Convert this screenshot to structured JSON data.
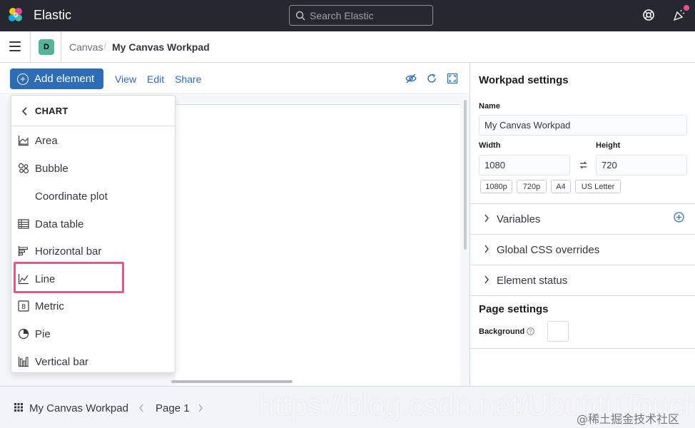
{
  "header": {
    "brand": "Elastic",
    "search_placeholder": "Search Elastic",
    "icons": [
      "elastic-logo-icon",
      "search-icon",
      "help-icon",
      "newsfeed-icon"
    ]
  },
  "breadcrumb": {
    "space_initial": "D",
    "items": [
      "Canvas",
      "My Canvas Workpad"
    ],
    "separator": "/"
  },
  "toolbar": {
    "add_label": "Add element",
    "links": [
      "View",
      "Edit",
      "Share"
    ],
    "icons": [
      "hide-icon",
      "refresh-icon",
      "fullscreen-icon"
    ]
  },
  "menu": {
    "back_icon": "chevron-left-icon",
    "title": "CHART",
    "items": [
      {
        "label": "Area",
        "icon": "area-chart-icon"
      },
      {
        "label": "Bubble",
        "icon": "bubble-chart-icon"
      },
      {
        "label": "Coordinate plot",
        "icon": ""
      },
      {
        "label": "Data table",
        "icon": "table-icon"
      },
      {
        "label": "Horizontal bar",
        "icon": "horizontal-bar-icon"
      },
      {
        "label": "Line",
        "icon": "line-chart-icon"
      },
      {
        "label": "Metric",
        "icon": "metric-icon"
      },
      {
        "label": "Pie",
        "icon": "pie-chart-icon"
      },
      {
        "label": "Vertical bar",
        "icon": "vertical-bar-icon"
      }
    ],
    "highlighted": "Line",
    "highlight_color": "#dc5c8c"
  },
  "workpad_settings": {
    "title": "Workpad settings",
    "name_label": "Name",
    "name_value": "My Canvas Workpad",
    "width_label": "Width",
    "width_value": "1080",
    "height_label": "Height",
    "height_value": "720",
    "presets": [
      "1080p",
      "720p",
      "A4",
      "US Letter"
    ],
    "sections": [
      "Variables",
      "Global CSS overrides",
      "Element status"
    ]
  },
  "page_settings": {
    "title": "Page settings",
    "background_label": "Background",
    "background_color": "#ffffff"
  },
  "footer": {
    "workpad_name": "My Canvas Workpad",
    "page_label": "Page 1"
  },
  "watermark": {
    "url": "https://blog.csdn.net/UbuntuTouch",
    "credit": "@稀土掘金技术社区"
  },
  "colors": {
    "accent": "#2c6db6",
    "header_bg": "#25282f",
    "space_badge": "#54b399"
  }
}
